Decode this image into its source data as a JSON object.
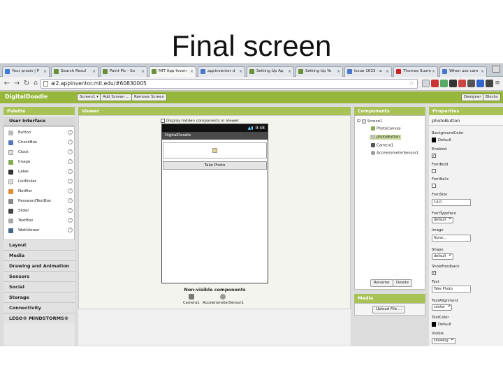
{
  "slide_title": "Final screen",
  "tabs": [
    {
      "label": "Your prezis | P",
      "color": "#3a7bd5"
    },
    {
      "label": "Search Resul",
      "color": "#6a8f3a"
    },
    {
      "label": "Paint Pic - So",
      "color": "#6a8f3a"
    },
    {
      "label": "MIT App Inven",
      "color": "#6a8f3a",
      "active": true
    },
    {
      "label": "appinventor d",
      "color": "#4a78c8"
    },
    {
      "label": "Setting Up Ap",
      "color": "#6a8f3a"
    },
    {
      "label": "Setting Up Yo",
      "color": "#6a8f3a"
    },
    {
      "label": "Issue 1633 - a",
      "color": "#4a78c8"
    },
    {
      "label": "Thomas Suom",
      "color": "#cc2222"
    },
    {
      "label": "When use cam",
      "color": "#4a78c8"
    }
  ],
  "address": {
    "url": "ai2.appinventor.mit.edu/#60830005"
  },
  "app": {
    "name": "DigitalDoodle",
    "screen_select": "Screen1 ▾",
    "add_screen": "Add Screen ...",
    "remove_screen": "Remove Screen",
    "designer": "Designer",
    "blocks": "Blocks"
  },
  "palette": {
    "title": "Palette",
    "open_category": "User Interface",
    "items": [
      {
        "label": "Button",
        "color": "#bbbbbb"
      },
      {
        "label": "CheckBox",
        "color": "#5577bb"
      },
      {
        "label": "Clock",
        "color": "#dddddd"
      },
      {
        "label": "Image",
        "color": "#88aa55"
      },
      {
        "label": "Label",
        "color": "#333333"
      },
      {
        "label": "ListPicker",
        "color": "#dddddd"
      },
      {
        "label": "Notifier",
        "color": "#e08a3a"
      },
      {
        "label": "PasswordTextBox",
        "color": "#888888"
      },
      {
        "label": "Slider",
        "color": "#444444"
      },
      {
        "label": "TextBox",
        "color": "#aaaaaa"
      },
      {
        "label": "WebViewer",
        "color": "#446688"
      }
    ],
    "categories": [
      "Layout",
      "Media",
      "Drawing and Animation",
      "Sensors",
      "Social",
      "Storage",
      "Connectivity",
      "LEGO® MINDSTORMS®"
    ]
  },
  "viewer": {
    "title": "Viewer",
    "hidden_checkbox": "Display hidden components in Viewer",
    "time": "9:48",
    "screen_title": "DigitalDoodle",
    "button_text": "Take Photo",
    "nonvisible_title": "Non-visible components",
    "nonvisible": [
      "Camera1",
      "AccelerometerSensor1"
    ]
  },
  "components": {
    "title": "Components",
    "root": "Screen1",
    "children": [
      "PhotoCanvas",
      "photoButton",
      "Camera1",
      "AccelerometerSensor1"
    ],
    "rename": "Rename",
    "delete": "Delete"
  },
  "media": {
    "title": "Media",
    "upload": "Upload File ..."
  },
  "properties": {
    "title": "Properties",
    "component": "photoButton",
    "background_color_label": "BackgroundColor",
    "background_color_value": "Default",
    "enabled_label": "Enabled",
    "fontbold_label": "FontBold",
    "fontitalic_label": "FontItalic",
    "fontsize_label": "FontSize",
    "fontsize_value": "14.0",
    "fonttypeface_label": "FontTypeface",
    "fonttypeface_value": "default",
    "image_label": "Image",
    "image_value": "None...",
    "shape_label": "Shape",
    "shape_value": "default",
    "showfeedback_label": "ShowFeedback",
    "text_label": "Text",
    "text_value": "Take Photo",
    "textalignment_label": "TextAlignment",
    "textalignment_value": "center",
    "textcolor_label": "TextColor",
    "textcolor_value": "Default",
    "visible_label": "Visible",
    "visible_value": "showing"
  }
}
